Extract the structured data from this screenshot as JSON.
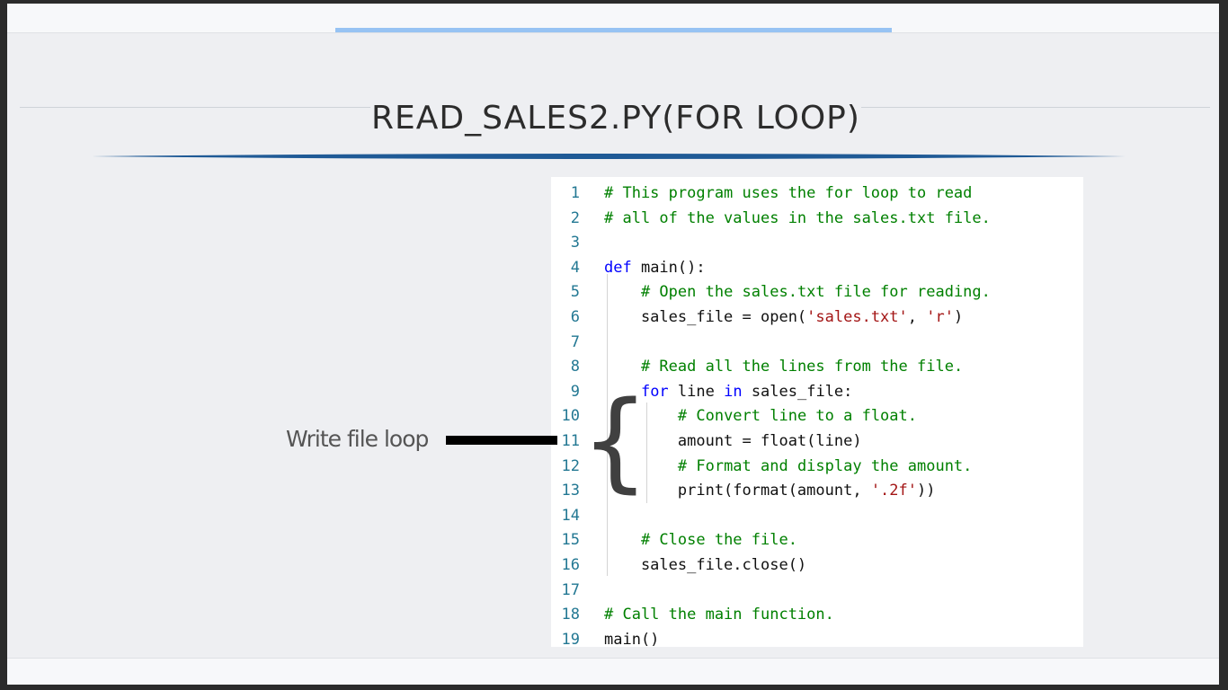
{
  "slide": {
    "title": "READ_SALES2.PY(FOR LOOP)",
    "annotation_label": "Write file loop",
    "brace_glyph": "{"
  },
  "code": {
    "lines": [
      {
        "number": "1",
        "segments": [
          {
            "text": "# This program uses the for loop to read",
            "style": "comment"
          }
        ]
      },
      {
        "number": "2",
        "segments": [
          {
            "text": "# all of the values in the sales.txt file.",
            "style": "comment"
          }
        ]
      },
      {
        "number": "3",
        "segments": []
      },
      {
        "number": "4",
        "segments": [
          {
            "text": "def",
            "style": "kw"
          },
          {
            "text": " main():",
            "style": "plain"
          }
        ]
      },
      {
        "number": "5",
        "segments": [
          {
            "text": "    ",
            "style": "plain"
          },
          {
            "text": "# Open the sales.txt file for reading.",
            "style": "comment"
          }
        ]
      },
      {
        "number": "6",
        "segments": [
          {
            "text": "    sales_file = open(",
            "style": "plain"
          },
          {
            "text": "'sales.txt'",
            "style": "str"
          },
          {
            "text": ", ",
            "style": "plain"
          },
          {
            "text": "'r'",
            "style": "str"
          },
          {
            "text": ")",
            "style": "plain"
          }
        ]
      },
      {
        "number": "7",
        "segments": []
      },
      {
        "number": "8",
        "segments": [
          {
            "text": "    ",
            "style": "plain"
          },
          {
            "text": "# Read all the lines from the file.",
            "style": "comment"
          }
        ]
      },
      {
        "number": "9",
        "segments": [
          {
            "text": "    ",
            "style": "plain"
          },
          {
            "text": "for",
            "style": "kw"
          },
          {
            "text": " line ",
            "style": "plain"
          },
          {
            "text": "in",
            "style": "kw"
          },
          {
            "text": " sales_file:",
            "style": "plain"
          }
        ]
      },
      {
        "number": "10",
        "segments": [
          {
            "text": "        ",
            "style": "plain"
          },
          {
            "text": "# Convert line to a float.",
            "style": "comment"
          }
        ]
      },
      {
        "number": "11",
        "segments": [
          {
            "text": "        amount = float(line)",
            "style": "plain"
          }
        ]
      },
      {
        "number": "12",
        "segments": [
          {
            "text": "        ",
            "style": "plain"
          },
          {
            "text": "# Format and display the amount.",
            "style": "comment"
          }
        ]
      },
      {
        "number": "13",
        "segments": [
          {
            "text": "        print(format(amount, ",
            "style": "plain"
          },
          {
            "text": "'.2f'",
            "style": "str"
          },
          {
            "text": "))",
            "style": "plain"
          }
        ]
      },
      {
        "number": "14",
        "segments": []
      },
      {
        "number": "15",
        "segments": [
          {
            "text": "    ",
            "style": "plain"
          },
          {
            "text": "# Close the file.",
            "style": "comment"
          }
        ]
      },
      {
        "number": "16",
        "segments": [
          {
            "text": "    sales_file.close()",
            "style": "plain"
          }
        ]
      },
      {
        "number": "17",
        "segments": []
      },
      {
        "number": "18",
        "segments": [
          {
            "text": "# Call the main function.",
            "style": "comment"
          }
        ]
      },
      {
        "number": "19",
        "segments": [
          {
            "text": "main()",
            "style": "plain"
          }
        ]
      }
    ]
  },
  "colors": {
    "comment": "#008000",
    "keyword": "#0000ff",
    "string": "#a31515",
    "line_number": "#237893",
    "accent_bar": "#97c3f3",
    "title_underline": "#1f5a96"
  }
}
